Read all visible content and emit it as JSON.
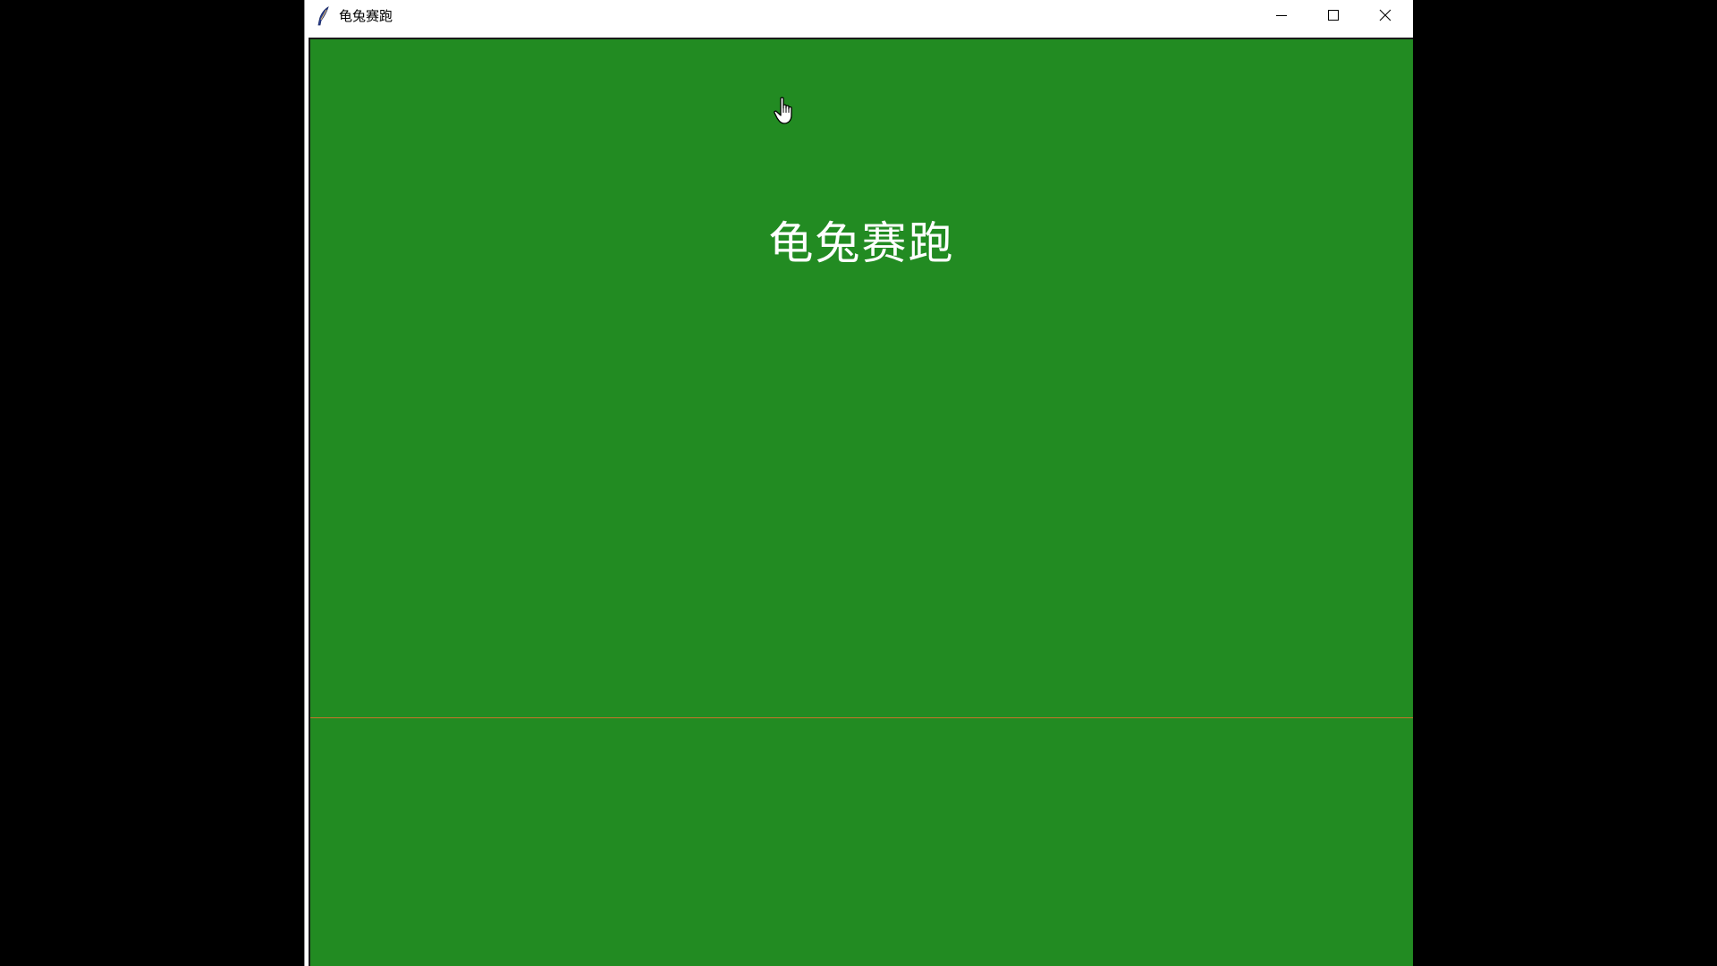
{
  "window": {
    "title": "龟兔赛跑",
    "controls": {
      "minimize_icon": "minimize-icon",
      "maximize_icon": "maximize-icon",
      "close_icon": "close-icon"
    },
    "app_icon": "feather-icon"
  },
  "canvas": {
    "background_color": "#228b22",
    "heading": "龟兔赛跑",
    "heading_color": "#ffffff",
    "line_color": "#c8732a"
  },
  "pointer": {
    "icon": "hand-pointer-icon"
  }
}
